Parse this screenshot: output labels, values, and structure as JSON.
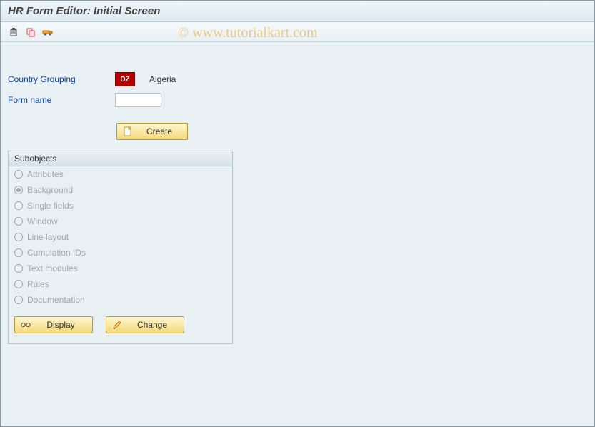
{
  "title": "HR Form Editor: Initial Screen",
  "watermark": "© www.tutorialkart.com",
  "fields": {
    "country_label": "Country Grouping",
    "country_code": "DZ",
    "country_name": "Algeria",
    "formname_label": "Form name",
    "formname_value": ""
  },
  "buttons": {
    "create": "Create",
    "display": "Display",
    "change": "Change"
  },
  "groupbox": {
    "title": "Subobjects",
    "items": [
      {
        "label": "Attributes",
        "selected": false
      },
      {
        "label": "Background",
        "selected": true
      },
      {
        "label": "Single fields",
        "selected": false
      },
      {
        "label": "Window",
        "selected": false
      },
      {
        "label": "Line layout",
        "selected": false
      },
      {
        "label": "Cumulation IDs",
        "selected": false
      },
      {
        "label": "Text modules",
        "selected": false
      },
      {
        "label": "Rules",
        "selected": false
      },
      {
        "label": "Documentation",
        "selected": false
      }
    ]
  }
}
